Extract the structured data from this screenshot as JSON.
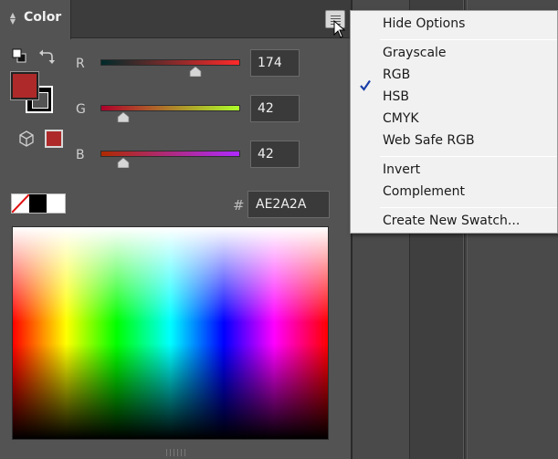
{
  "panel": {
    "title": "Color",
    "tab_icon": "collapse-arrows-icon",
    "menu_icon": "panel-menu-icon"
  },
  "fill_stroke": {
    "fill_color": "#ae2a2a",
    "stroke_color": "#000000",
    "gamut_color": "#ae2a2a"
  },
  "channels": [
    {
      "label": "R",
      "value": "174",
      "fraction": 0.682
    },
    {
      "label": "G",
      "value": "42",
      "fraction": 0.165
    },
    {
      "label": "B",
      "value": "42",
      "fraction": 0.165
    }
  ],
  "hex": {
    "prefix": "#",
    "value": "AE2A2A"
  },
  "menu": {
    "groups": [
      [
        "Hide Options"
      ],
      [
        "Grayscale",
        "RGB",
        "HSB",
        "CMYK",
        "Web Safe RGB"
      ],
      [
        "Invert",
        "Complement"
      ],
      [
        "Create New Swatch..."
      ]
    ],
    "checked_item": "RGB"
  }
}
